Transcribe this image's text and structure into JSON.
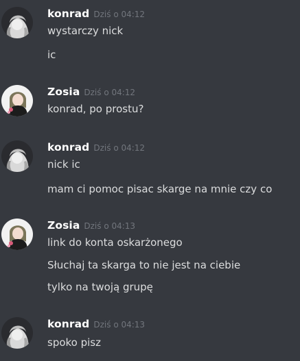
{
  "colors": {
    "background": "#36393f",
    "username": "#ffffff",
    "timestamp": "#72767d",
    "message_text": "#dcddde"
  },
  "messages": [
    {
      "author": "konrad",
      "avatar_icon": "konrad-avatar-icon",
      "timestamp": "Dziś o 04:12",
      "lines": [
        "wystarczy nick",
        "ic"
      ]
    },
    {
      "author": "Zosia",
      "avatar_icon": "zosia-avatar-icon",
      "timestamp": "Dziś o 04:12",
      "lines": [
        "konrad, po prostu?"
      ]
    },
    {
      "author": "konrad",
      "avatar_icon": "konrad-avatar-icon",
      "timestamp": "Dziś o 04:12",
      "lines": [
        "nick ic",
        "mam ci pomoc pisac skarge na mnie czy co"
      ]
    },
    {
      "author": "Zosia",
      "avatar_icon": "zosia-avatar-icon",
      "timestamp": "Dziś o 04:13",
      "lines": [
        "link do konta oskarżonego",
        "Słuchaj ta skarga to nie jest na ciebie",
        "tylko na twoją grupę"
      ]
    },
    {
      "author": "konrad",
      "avatar_icon": "konrad-avatar-icon",
      "timestamp": "Dziś o 04:13",
      "lines": [
        "spoko pisz"
      ]
    }
  ]
}
